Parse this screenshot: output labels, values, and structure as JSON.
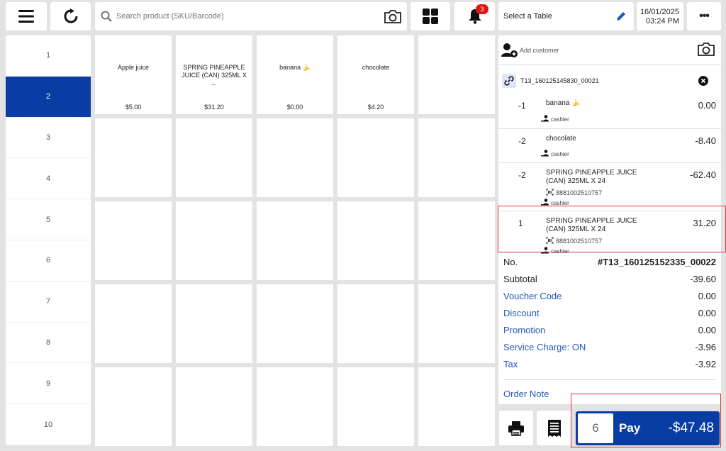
{
  "search": {
    "placeholder": "Search product (SKU/Barcode)"
  },
  "notifications": {
    "count": "3"
  },
  "table_select": {
    "label": "Select a Table"
  },
  "datetime": {
    "date": "16/01/2025",
    "time": "03:24 PM"
  },
  "more": {
    "label": "•••"
  },
  "tables": [
    "1",
    "2",
    "3",
    "4",
    "5",
    "6",
    "7",
    "8",
    "9",
    "10"
  ],
  "active_table": "2",
  "products": [
    {
      "name": "Apple juice",
      "price": "$5.00"
    },
    {
      "name": "SPRING PINEAPPLE JUICE (CAN) 325ML X ...",
      "price": "$31.20"
    },
    {
      "name": "banana 🍌",
      "price": "$0.00"
    },
    {
      "name": "chocolate",
      "price": "$4.20"
    }
  ],
  "customer": {
    "add_label": "Add customer"
  },
  "ticket": {
    "number": "T13_160125145830_00021"
  },
  "order_lines": [
    {
      "qty": "-1",
      "name": "banana 🍌",
      "amount": "0.00",
      "sku": "",
      "cashier": "cashier"
    },
    {
      "qty": "-2",
      "name": "chocolate",
      "amount": "-8.40",
      "sku": "",
      "cashier": "cashier"
    },
    {
      "qty": "-2",
      "name": "SPRING PINEAPPLE JUICE (CAN) 325ML X 24",
      "amount": "-62.40",
      "sku": "8881002510757",
      "cashier": "cashier"
    },
    {
      "qty": "1",
      "name": "SPRING PINEAPPLE JUICE (CAN) 325ML X 24",
      "amount": "31.20",
      "sku": "8881002510757",
      "cashier": "cashier"
    }
  ],
  "summary": {
    "order_no_label": "No.",
    "order_no": "#T13_160125152335_00022",
    "subtotal_label": "Subtotal",
    "subtotal": "-39.60",
    "voucher_label": "Voucher Code",
    "voucher": "0.00",
    "discount_label": "Discount",
    "discount": "0.00",
    "promotion_label": "Promotion",
    "promotion": "0.00",
    "service_label": "Service Charge: ON",
    "service": "-3.96",
    "tax_label": "Tax",
    "tax": "-3.92",
    "order_note_label": "Order Note"
  },
  "pay": {
    "count": "6",
    "label": "Pay",
    "total": "-$47.48"
  },
  "colors": {
    "primary": "#0a3da3",
    "link": "#2458b8",
    "badge": "#e01515"
  }
}
